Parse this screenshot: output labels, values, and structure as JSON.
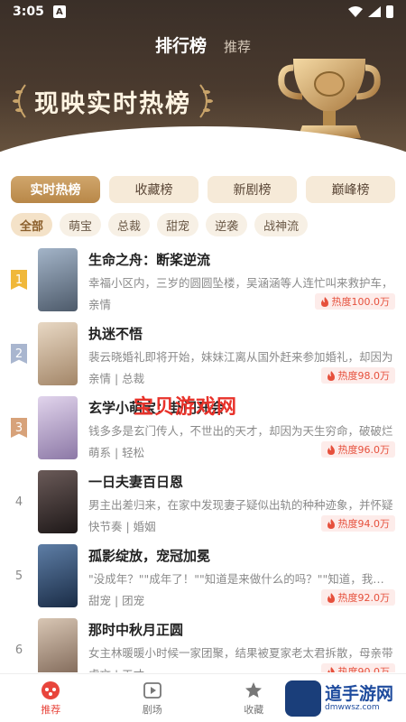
{
  "status_bar": {
    "time": "3:05",
    "app_indicator": "A"
  },
  "top_nav": {
    "active": "排行榜",
    "other": "推荐"
  },
  "hero": {
    "title": "现映实时热榜"
  },
  "tabs": [
    {
      "label": "实时热榜",
      "active": true
    },
    {
      "label": "收藏榜",
      "active": false
    },
    {
      "label": "新剧榜",
      "active": false
    },
    {
      "label": "巅峰榜",
      "active": false
    }
  ],
  "chips": [
    {
      "label": "全部",
      "active": true
    },
    {
      "label": "萌宝",
      "active": false
    },
    {
      "label": "总裁",
      "active": false
    },
    {
      "label": "甜宠",
      "active": false
    },
    {
      "label": "逆袭",
      "active": false
    },
    {
      "label": "战神流",
      "active": false
    }
  ],
  "list": [
    {
      "rank": "1",
      "title": "生命之舟：断桨逆流",
      "desc": "幸福小区内，三岁的圆圆坠楼，吴涵涵等人连忙叫来救护车，",
      "tags": "亲情",
      "heat": "热度100.0万",
      "cover_color": "#6b7a8f"
    },
    {
      "rank": "2",
      "title": "执迷不悟",
      "desc": "裴云晓婚礼即将开始，妹妹江离从国外赶来参加婚礼，却因为",
      "tags": "亲情 | 总裁",
      "heat": "热度98.0万",
      "cover_color": "#c9b29a"
    },
    {
      "rank": "3",
      "title": "玄学小萌宝：卦门开会",
      "desc": "钱多多是玄门传人，不世出的天才，却因为天生穷命，破破烂",
      "tags": "萌系 | 轻松",
      "heat": "热度96.0万",
      "cover_color": "#b9a5c9"
    },
    {
      "rank": "4",
      "title": "一日夫妻百日恩",
      "desc": "男主出差归来，在家中发现妻子疑似出轨的种种迹象，并怀疑",
      "tags": "快节奏 | 婚姻",
      "heat": "热度94.0万",
      "cover_color": "#3a3030"
    },
    {
      "rank": "5",
      "title": "孤影绽放，宠冠加冕",
      "desc": "\"没成年？\"\"成年了！\"\"知道是来做什么的吗？\"\"知道，我会好好",
      "tags": "甜宠 | 团宠",
      "heat": "热度92.0万",
      "cover_color": "#2f4a6b"
    },
    {
      "rank": "6",
      "title": "那时中秋月正圆",
      "desc": "女主林暖暖小时候一家团聚，结果被夏家老太君拆散，母亲带",
      "tags": "虐文 | 天才",
      "heat": "热度90.0万",
      "cover_color": "#a08a7a"
    }
  ],
  "watermark": "宝贝游戏网",
  "bottom_nav": [
    {
      "label": "推荐",
      "icon": "recommend-icon",
      "active": true
    },
    {
      "label": "剧场",
      "icon": "theater-icon",
      "active": false
    },
    {
      "label": "收藏",
      "icon": "star-icon",
      "active": false
    }
  ],
  "brand": {
    "name": "道手游网",
    "url": "dmwwsz.com"
  },
  "colors": {
    "accent": "#e8453c",
    "gold": "#c29456",
    "hero_bg": "#3a2f28"
  }
}
